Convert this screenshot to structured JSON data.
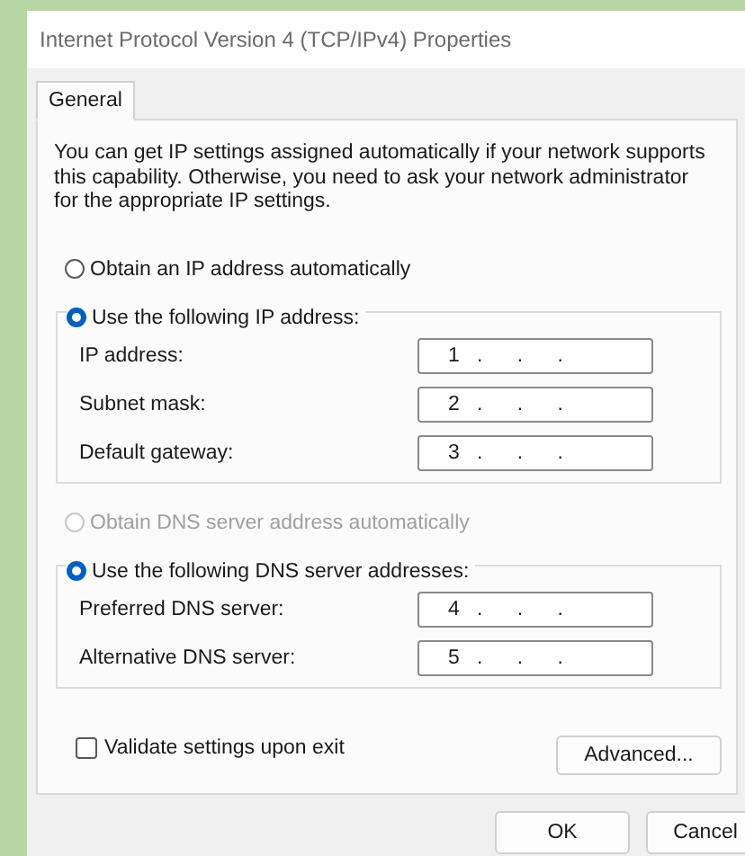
{
  "window": {
    "title": "Internet Protocol Version 4 (TCP/IPv4) Properties"
  },
  "tabs": [
    {
      "label": "General",
      "selected": true
    }
  ],
  "description": "You can get IP settings assigned automatically if your network supports this capability. Otherwise, you need to ask your network administrator for the appropriate IP settings.",
  "ip_mode": [
    {
      "label": "Obtain an IP address automatically",
      "selected": false,
      "disabled": false
    },
    {
      "label": "Use the following IP address:",
      "selected": true,
      "disabled": false
    }
  ],
  "ip_fields": [
    {
      "label": "IP address:",
      "value": "1   .      .      ."
    },
    {
      "label": "Subnet mask:",
      "value": "2   .      .      ."
    },
    {
      "label": "Default gateway:",
      "value": "3   .      .      ."
    }
  ],
  "dns_mode": [
    {
      "label": "Obtain DNS server address automatically",
      "selected": false,
      "disabled": true
    },
    {
      "label": "Use the following DNS server addresses:",
      "selected": true,
      "disabled": false
    }
  ],
  "dns_fields": [
    {
      "label": "Preferred DNS server:",
      "value": "4   .      .      ."
    },
    {
      "label": "Alternative DNS server:",
      "value": "5   .      .      ."
    }
  ],
  "validate": {
    "label": "Validate settings upon exit",
    "checked": false
  },
  "advanced_button": "Advanced...",
  "buttons": [
    "OK",
    "Cancel"
  ]
}
